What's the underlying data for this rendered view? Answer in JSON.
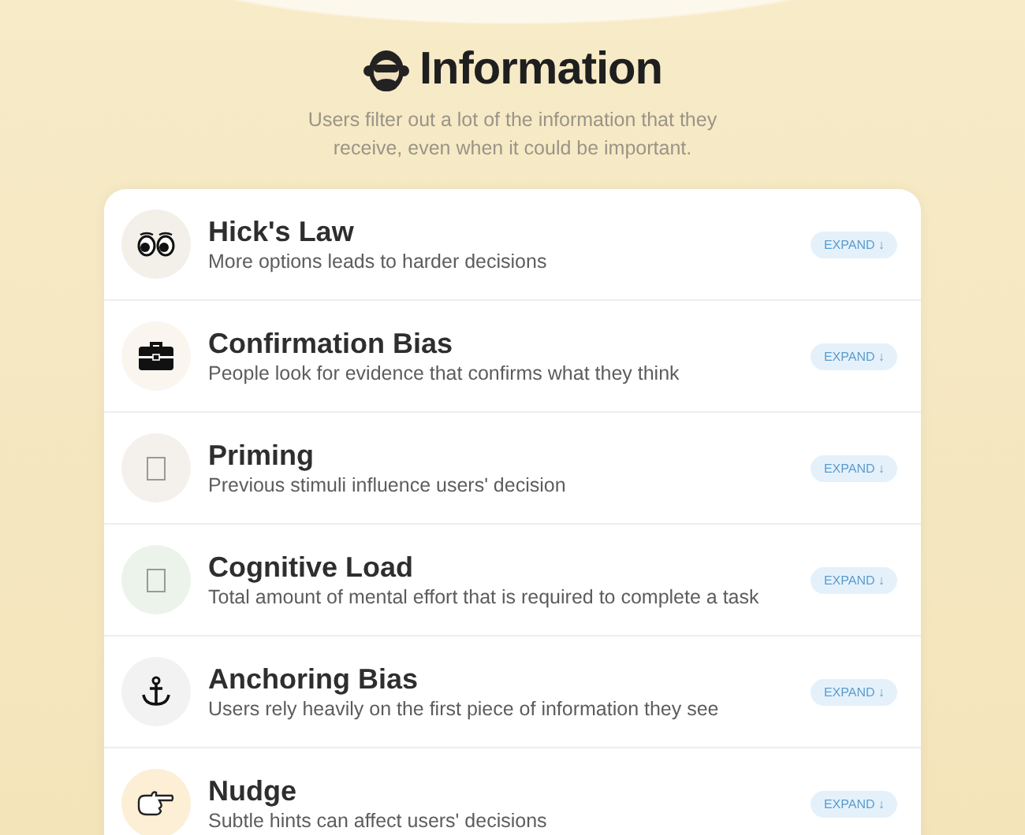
{
  "header": {
    "title": "Information",
    "subtitle": "Users filter out a lot of the information that they receive, even when it could be important."
  },
  "items": [
    {
      "kind": "eyes",
      "color": "#f3efe9",
      "title": "Hick's Law",
      "description": "More options leads to harder decisions",
      "button": "EXPAND ↓"
    },
    {
      "kind": "briefcase",
      "color": "#faf5ef",
      "title": "Confirmation Bias",
      "description": "People look for evidence that confirms what they think",
      "button": "EXPAND ↓"
    },
    {
      "kind": "missing",
      "color": "#f4f0ec",
      "title": "Priming",
      "description": "Previous stimuli influence users' decision",
      "button": "EXPAND ↓"
    },
    {
      "kind": "missing",
      "color": "#ebf3ea",
      "title": "Cognitive Load",
      "description": "Total amount of mental effort that is required to complete a task",
      "button": "EXPAND ↓"
    },
    {
      "kind": "anchor",
      "color": "#f2f2f2",
      "title": "Anchoring Bias",
      "description": "Users rely heavily on the first piece of information they see",
      "button": "EXPAND ↓"
    },
    {
      "kind": "hand",
      "color": "#fcefd6",
      "title": "Nudge",
      "description": "Subtle hints can affect users' decisions",
      "button": "EXPAND ↓"
    }
  ]
}
